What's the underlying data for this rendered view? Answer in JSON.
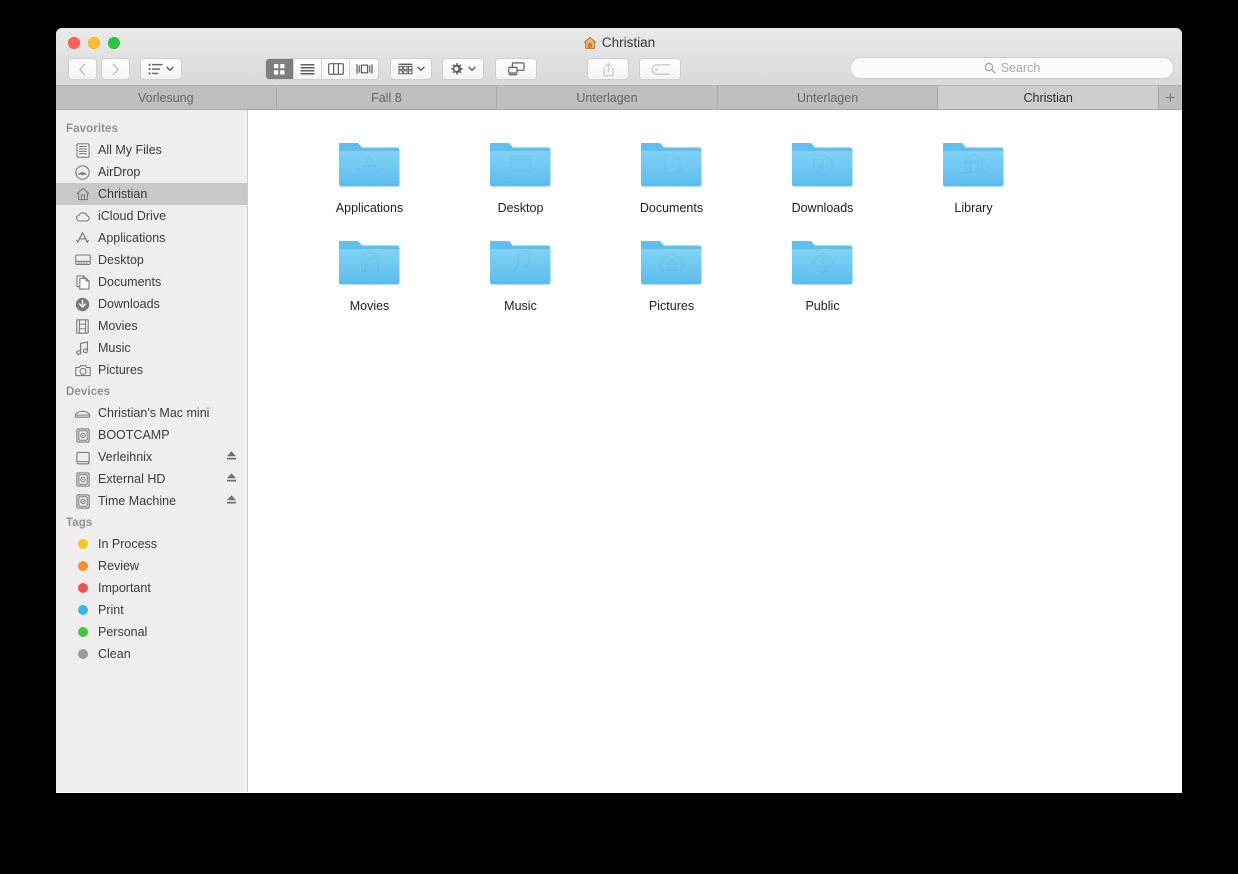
{
  "window": {
    "title": "Christian",
    "title_icon": "home-icon",
    "traffic_lights": [
      {
        "name": "close-button",
        "color": "#ff5f57"
      },
      {
        "name": "minimize-button",
        "color": "#febc2e"
      },
      {
        "name": "zoom-button",
        "color": "#28c840"
      }
    ]
  },
  "toolbar": {
    "back_label": "‹",
    "forward_label": "›",
    "arrange_tooltip": "Arrange",
    "view_modes": [
      {
        "name": "icon-view-button",
        "icon": "grid-icon",
        "active": true
      },
      {
        "name": "list-view-button",
        "icon": "list-icon",
        "active": false
      },
      {
        "name": "column-view-button",
        "icon": "columns-icon",
        "active": false
      },
      {
        "name": "coverflow-view-button",
        "icon": "coverflow-icon",
        "active": false
      }
    ],
    "group_tooltip": "Group items",
    "action_tooltip": "Action",
    "airdrop_tooltip": "AirDrop",
    "share_tooltip": "Share",
    "tag_tooltip": "Edit Tags"
  },
  "search": {
    "placeholder": "Search",
    "value": "",
    "icon": "search-icon"
  },
  "tabs": {
    "items": [
      {
        "label": "Vorlesung",
        "active": false
      },
      {
        "label": "Fall 8",
        "active": false
      },
      {
        "label": "Unterlagen",
        "active": false
      },
      {
        "label": "Unterlagen",
        "active": false
      },
      {
        "label": "Christian",
        "active": true
      }
    ],
    "new_tab_label": "+"
  },
  "sidebar": {
    "sections": [
      {
        "header": "Favorites",
        "items": [
          {
            "label": "All My Files",
            "icon": "all-my-files-icon",
            "selected": false,
            "eject": false
          },
          {
            "label": "AirDrop",
            "icon": "airdrop-icon",
            "selected": false,
            "eject": false
          },
          {
            "label": "Christian",
            "icon": "home-icon",
            "selected": true,
            "eject": false
          },
          {
            "label": "iCloud Drive",
            "icon": "cloud-icon",
            "selected": false,
            "eject": false
          },
          {
            "label": "Applications",
            "icon": "applications-icon",
            "selected": false,
            "eject": false
          },
          {
            "label": "Desktop",
            "icon": "desktop-icon",
            "selected": false,
            "eject": false
          },
          {
            "label": "Documents",
            "icon": "documents-icon",
            "selected": false,
            "eject": false
          },
          {
            "label": "Downloads",
            "icon": "downloads-icon",
            "selected": false,
            "eject": false
          },
          {
            "label": "Movies",
            "icon": "movies-icon",
            "selected": false,
            "eject": false
          },
          {
            "label": "Music",
            "icon": "music-icon",
            "selected": false,
            "eject": false
          },
          {
            "label": "Pictures",
            "icon": "pictures-icon",
            "selected": false,
            "eject": false
          }
        ]
      },
      {
        "header": "Devices",
        "items": [
          {
            "label": "Christian's Mac mini",
            "icon": "mac-mini-icon",
            "selected": false,
            "eject": false
          },
          {
            "label": "BOOTCAMP",
            "icon": "hard-disk-icon",
            "selected": false,
            "eject": false
          },
          {
            "label": "Verleihnix",
            "icon": "disk-icon",
            "selected": false,
            "eject": true
          },
          {
            "label": "External HD",
            "icon": "hard-disk-icon",
            "selected": false,
            "eject": true
          },
          {
            "label": "Time Machine",
            "icon": "hard-disk-icon",
            "selected": false,
            "eject": true
          }
        ]
      },
      {
        "header": "Tags",
        "items": [
          {
            "label": "In Process",
            "icon": "tag-dot-icon",
            "color": "#f5c518",
            "selected": false,
            "eject": false
          },
          {
            "label": "Review",
            "icon": "tag-dot-icon",
            "color": "#f5922f",
            "selected": false,
            "eject": false
          },
          {
            "label": "Important",
            "icon": "tag-dot-icon",
            "color": "#f0504a",
            "selected": false,
            "eject": false
          },
          {
            "label": "Print",
            "icon": "tag-dot-icon",
            "color": "#35b7f0",
            "selected": false,
            "eject": false
          },
          {
            "label": "Personal",
            "icon": "tag-dot-icon",
            "color": "#41c840",
            "selected": false,
            "eject": false
          },
          {
            "label": "Clean",
            "icon": "tag-dot-icon",
            "color": "#9a9a9a",
            "selected": false,
            "eject": false
          }
        ]
      }
    ]
  },
  "content": {
    "items": [
      {
        "label": "Applications",
        "icon": "folder-applications-icon"
      },
      {
        "label": "Desktop",
        "icon": "folder-desktop-icon"
      },
      {
        "label": "Documents",
        "icon": "folder-documents-icon"
      },
      {
        "label": "Downloads",
        "icon": "folder-downloads-icon"
      },
      {
        "label": "Library",
        "icon": "folder-library-icon"
      },
      {
        "label": "Movies",
        "icon": "folder-movies-icon"
      },
      {
        "label": "Music",
        "icon": "folder-music-icon"
      },
      {
        "label": "Pictures",
        "icon": "folder-pictures-icon"
      },
      {
        "label": "Public",
        "icon": "folder-public-icon"
      }
    ]
  },
  "colors": {
    "folder_blue": "#6ec6f0",
    "folder_blue_dark": "#4bb4e8",
    "selection_gray": "#c8c8c8",
    "tabbar_gray": "#bebebe",
    "active_tab_gray": "#cdcdcd",
    "sidebar_gray": "#eeeeee"
  }
}
